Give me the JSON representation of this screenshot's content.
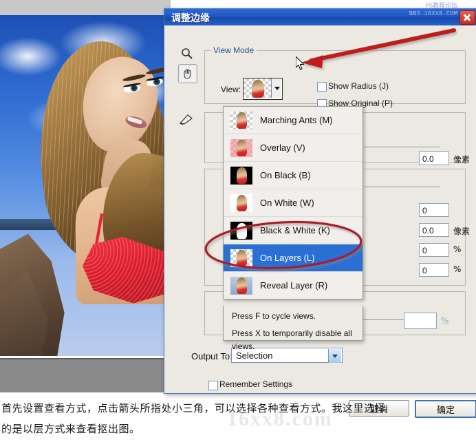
{
  "document_window": {
    "name": "photo-document",
    "photo_description": "portrait of woman with long hair against blue sky, red lace bra"
  },
  "dialog": {
    "title": "调整边缘",
    "close_label": "×",
    "watermark": {
      "line1": "PS教程论坛",
      "line2": "BBS.16XX8.COM"
    },
    "tools": [
      {
        "name": "zoom-tool",
        "glyph": "zoom"
      },
      {
        "name": "hand-tool",
        "glyph": "hand",
        "selected": true
      },
      {
        "name": "refine-brush-tool",
        "glyph": "brush"
      }
    ],
    "view_mode": {
      "legend": "View Mode",
      "view_label": "View:",
      "selected_view": "On Layers (L)",
      "checkboxes": [
        {
          "label": "Show Radius (J)",
          "checked": false
        },
        {
          "label": "Show Original (P)",
          "checked": false
        }
      ]
    },
    "view_dropdown": {
      "items": [
        {
          "label": "Marching Ants (M)",
          "thumb": "checker",
          "selected": false
        },
        {
          "label": "Overlay (V)",
          "thumb": "pink",
          "selected": false
        },
        {
          "label": "On Black (B)",
          "thumb": "black",
          "selected": false
        },
        {
          "label": "On White (W)",
          "thumb": "white",
          "selected": false
        },
        {
          "label": "Black & White (K)",
          "thumb": "black-silhouette",
          "selected": false
        },
        {
          "label": "On Layers (L)",
          "thumb": "checker",
          "selected": true
        },
        {
          "label": "Reveal Layer (R)",
          "thumb": "bluegrad",
          "selected": false
        }
      ],
      "hint_line1": "Press F to cycle views.",
      "hint_line2": "Press X to temporarily disable all views."
    },
    "edge_detection": {
      "fields": [
        {
          "value": "0.0",
          "unit": "像素"
        }
      ]
    },
    "adjust_edge": {
      "fields": [
        {
          "value": "0",
          "unit": ""
        },
        {
          "value": "0.0",
          "unit": "像素"
        },
        {
          "value": "0",
          "unit": "%"
        },
        {
          "value": "0",
          "unit": "%"
        }
      ]
    },
    "decontaminate": {
      "fields": [
        {
          "value": "",
          "unit": "%"
        }
      ]
    },
    "output": {
      "label": "Output To:",
      "value": "Selection"
    },
    "footer": {
      "remember_label": "Remember Settings",
      "remember_checked": false,
      "cancel_label": "取消",
      "ok_label": "确定"
    }
  },
  "annotations": {
    "arrow_color": "#bf1f1f",
    "ellipse_color": "#a81b2a",
    "arrow_target": "view-dropdown-arrow",
    "ellipse_target": "On Layers (L)"
  },
  "caption": {
    "line1": "首先设置查看方式，点击箭头所指处小三角，可以选择各种查看方式。我这里选择",
    "line2": "的是以层方式来查看抠出图。",
    "watermark": "16xx8.com"
  }
}
